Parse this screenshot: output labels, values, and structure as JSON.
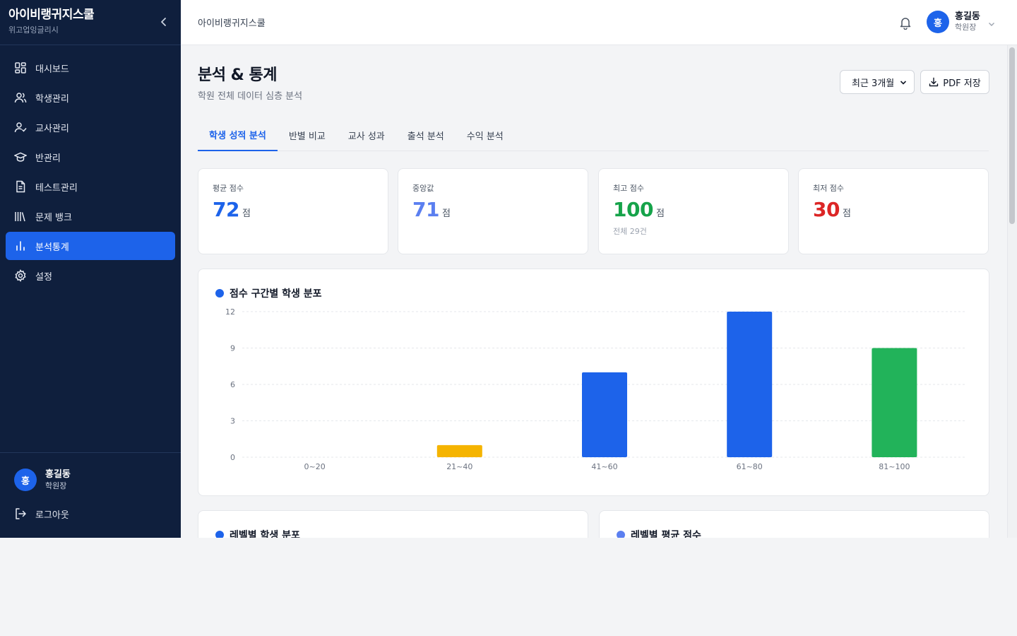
{
  "sidebar": {
    "brand_title": "아이비랭귀지스쿨",
    "brand_sub": "위고업잉글리시",
    "items": [
      {
        "label": "대시보드",
        "icon": "dashboard-icon"
      },
      {
        "label": "학생관리",
        "icon": "users-icon"
      },
      {
        "label": "교사관리",
        "icon": "user-check-icon"
      },
      {
        "label": "반관리",
        "icon": "graduation-cap-icon"
      },
      {
        "label": "테스트관리",
        "icon": "document-icon"
      },
      {
        "label": "문제 뱅크",
        "icon": "library-icon"
      },
      {
        "label": "분석통계",
        "icon": "bar-chart-icon",
        "active": true
      },
      {
        "label": "설정",
        "icon": "gear-icon"
      }
    ],
    "user": {
      "avatar": "홍",
      "name": "홍길동",
      "role": "학원장"
    },
    "logout_label": "로그아웃"
  },
  "topbar": {
    "breadcrumb": "아이비랭귀지스쿨",
    "user": {
      "avatar": "홍",
      "name": "홍길동",
      "role": "학원장"
    }
  },
  "page": {
    "title": "분석 & 통계",
    "subtitle": "학원 전체 데이터 심층 분석",
    "period_selected": "최근 3개월",
    "pdf_label": "PDF 저장",
    "tabs": [
      "학생 성적 분석",
      "반별 비교",
      "교사 성과",
      "출석 분석",
      "수익 분석"
    ],
    "active_tab": 0
  },
  "stats": [
    {
      "label": "평균 점수",
      "value": "72",
      "unit": "점",
      "color": "#1d63ea",
      "note": ""
    },
    {
      "label": "중앙값",
      "value": "71",
      "unit": "점",
      "color": "#5b7ff0",
      "note": ""
    },
    {
      "label": "최고 점수",
      "value": "100",
      "unit": "점",
      "color": "#16a34a",
      "note": "전체 29건"
    },
    {
      "label": "최저 점수",
      "value": "30",
      "unit": "점",
      "color": "#dc2626",
      "note": ""
    }
  ],
  "chart_card": {
    "title": "점수 구간별 학생 분포"
  },
  "chart_data": {
    "type": "bar",
    "title": "점수 구간별 학생 분포",
    "categories": [
      "0~20",
      "21~40",
      "41~60",
      "61~80",
      "81~100"
    ],
    "values": [
      0,
      1,
      7,
      12,
      9
    ],
    "bar_colors": [
      "#1d63ea",
      "#f5b400",
      "#1d63ea",
      "#1d63ea",
      "#22b35a"
    ],
    "ylim": [
      0,
      12
    ],
    "yticks": [
      0,
      3,
      6,
      9,
      12
    ],
    "grid": true
  },
  "bottom_cards": [
    {
      "title": "레벨별 학생 분포"
    },
    {
      "title": "레벨별 평균 점수"
    }
  ],
  "colors": {
    "sidebar_bg": "#0f1f3d",
    "accent": "#1d63ea"
  }
}
